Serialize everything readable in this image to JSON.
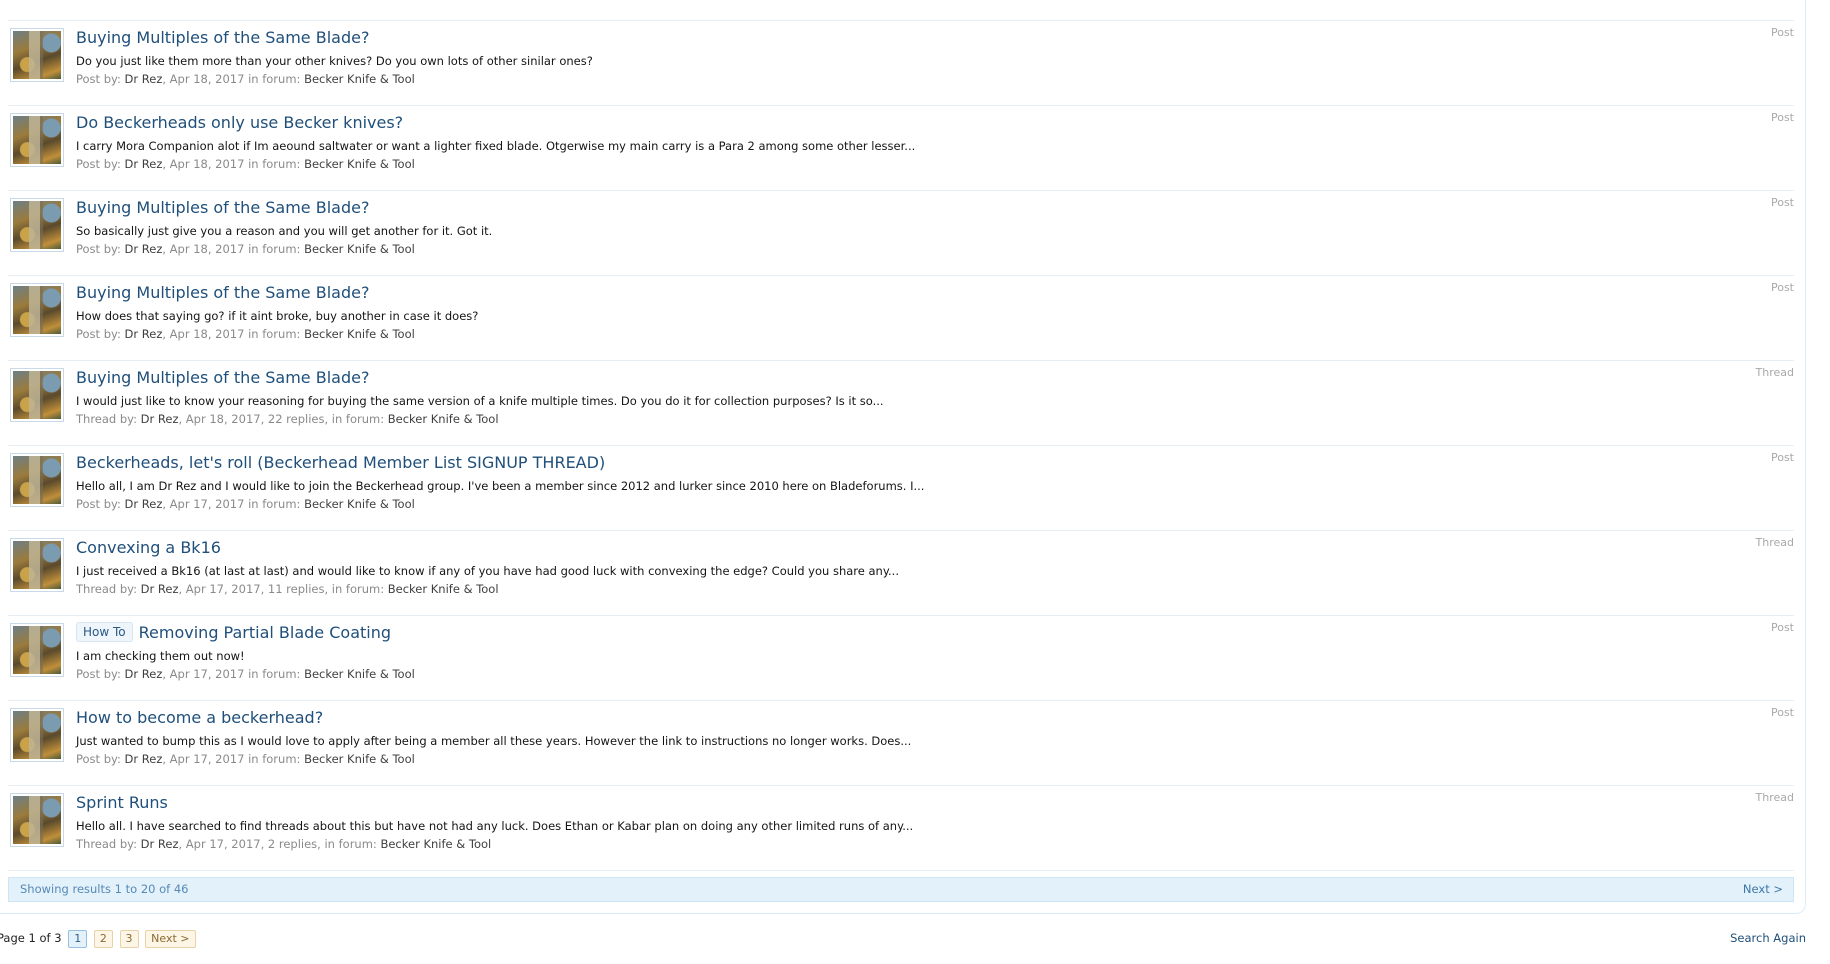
{
  "results": [
    {
      "title": "Buying Multiples of the Same Blade?",
      "snippet": "Do you just like them more than your other knives? Do you own lots of other sinilar ones?",
      "meta_label": "Post by:",
      "author": "Dr Rez",
      "date": ", Apr 18, 2017 in forum: ",
      "forum": "Becker Knife & Tool",
      "type": "Post"
    },
    {
      "title": "Do Beckerheads only use Becker knives?",
      "snippet": "I carry Mora Companion alot if Im aeound saltwater or want a lighter fixed blade. Otgerwise my main carry is a Para 2 among some other lesser...",
      "meta_label": "Post by:",
      "author": "Dr Rez",
      "date": ", Apr 18, 2017 in forum: ",
      "forum": "Becker Knife & Tool",
      "type": "Post"
    },
    {
      "title": "Buying Multiples of the Same Blade?",
      "snippet": "So basically just give you a reason and you will get another for it. Got it.",
      "meta_label": "Post by:",
      "author": "Dr Rez",
      "date": ", Apr 18, 2017 in forum: ",
      "forum": "Becker Knife & Tool",
      "type": "Post"
    },
    {
      "title": "Buying Multiples of the Same Blade?",
      "snippet": "How does that saying go? if it aint broke, buy another in case it does?",
      "meta_label": "Post by:",
      "author": "Dr Rez",
      "date": ", Apr 18, 2017 in forum: ",
      "forum": "Becker Knife & Tool",
      "type": "Post"
    },
    {
      "title": "Buying Multiples of the Same Blade?",
      "snippet": "I would just like to know your reasoning for buying the same version of a knife multiple times. Do you do it for collection purposes? Is it so...",
      "meta_label": "Thread by:",
      "author": "Dr Rez",
      "date": ", Apr 18, 2017, 22 replies, in forum: ",
      "forum": "Becker Knife & Tool",
      "type": "Thread"
    },
    {
      "title": "Beckerheads, let's roll (Beckerhead Member List SIGNUP THREAD)",
      "snippet": "Hello all, I am Dr Rez and I would like to join the Beckerhead group. I've been a member since 2012 and lurker since 2010 here on Bladeforums. I...",
      "meta_label": "Post by:",
      "author": "Dr Rez",
      "date": ", Apr 17, 2017 in forum: ",
      "forum": "Becker Knife & Tool",
      "type": "Post"
    },
    {
      "title": "Convexing a Bk16",
      "snippet": "I just received a Bk16 (at last at last) and would like to know if any of you have had good luck with convexing the edge? Could you share any...",
      "meta_label": "Thread by:",
      "author": "Dr Rez",
      "date": ", Apr 17, 2017, 11 replies, in forum: ",
      "forum": "Becker Knife & Tool",
      "type": "Thread"
    },
    {
      "prefix": "How To",
      "title": "Removing Partial Blade Coating",
      "snippet": "I am checking them out now!",
      "meta_label": "Post by:",
      "author": "Dr Rez",
      "date": ", Apr 17, 2017 in forum: ",
      "forum": "Becker Knife & Tool",
      "type": "Post"
    },
    {
      "title": "How to become a beckerhead?",
      "snippet": "Just wanted to bump this as I would love to apply after being a member all these years. However the link to instructions no longer works. Does...",
      "meta_label": "Post by:",
      "author": "Dr Rez",
      "date": ", Apr 17, 2017 in forum: ",
      "forum": "Becker Knife & Tool",
      "type": "Post"
    },
    {
      "title": "Sprint Runs",
      "snippet": "Hello all. I have searched to find threads about this but have not had any luck. Does Ethan or Kabar plan on doing any other limited runs of any...",
      "meta_label": "Thread by:",
      "author": "Dr Rez",
      "date": ", Apr 17, 2017, 2 replies, in forum: ",
      "forum": "Becker Knife & Tool",
      "type": "Thread"
    }
  ],
  "footer": {
    "showing": "Showing results 1 to 20 of 46",
    "next": "Next >"
  },
  "pagination": {
    "label": "Page 1 of 3",
    "pages": [
      "1",
      "2",
      "3"
    ],
    "next": "Next >"
  },
  "search_again": "Search Again"
}
